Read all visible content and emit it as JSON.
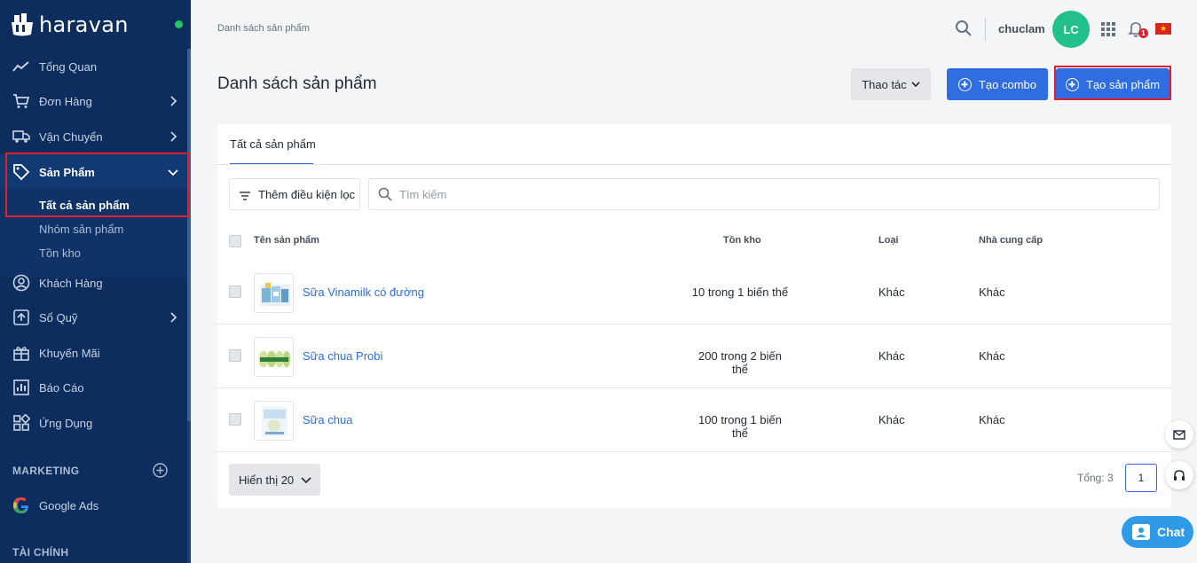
{
  "brand": {
    "name": "haravan"
  },
  "sidebar": {
    "items": [
      {
        "label": "Tổng Quan",
        "icon": "chart-line-icon"
      },
      {
        "label": "Đơn Hàng",
        "icon": "cart-icon"
      },
      {
        "label": "Vận Chuyển",
        "icon": "truck-icon"
      },
      {
        "label": "Sản Phẩm",
        "icon": "tag-icon"
      },
      {
        "label": "Khách Hàng",
        "icon": "user-circle-icon"
      },
      {
        "label": "Sổ Quỹ",
        "icon": "cashbook-icon"
      },
      {
        "label": "Khuyến Mãi",
        "icon": "gift-icon"
      },
      {
        "label": "Báo Cáo",
        "icon": "report-icon"
      },
      {
        "label": "Ứng Dụng",
        "icon": "apps-grid-icon"
      }
    ],
    "sub_items": [
      "Tất cả sản phẩm",
      "Nhóm sản phẩm",
      "Tồn kho"
    ],
    "marketing_title": "MARKETING",
    "google_ads": "Google Ads",
    "finance_title": "TÀI CHÍNH"
  },
  "topbar": {
    "breadcrumb": "Danh sách sản phẩm",
    "username": "chuclam",
    "avatar_initials": "LC",
    "notification_count": "1"
  },
  "header": {
    "title": "Danh sách sản phẩm",
    "actions_label": "Thao tác",
    "combo_label": "Tạo combo",
    "create_label": "Tạo sản phẩm"
  },
  "card": {
    "tab": "Tất cả sản phẩm",
    "filter_label": "Thêm điều kiện lọc",
    "search_placeholder": "Tìm kiếm",
    "columns": [
      "Tên sản phẩm",
      "Tồn kho",
      "Loại",
      "Nhà cung cấp"
    ],
    "rows": [
      {
        "name": "Sữa Vinamilk có đường",
        "stock": "10 trong 1 biến thể",
        "type": "Khác",
        "vendor": "Khác"
      },
      {
        "name": "Sữa chua Probi",
        "stock": "200 trong 2 biến thể",
        "type": "Khác",
        "vendor": "Khác"
      },
      {
        "name": "Sữa chua",
        "stock": "100 trong 1 biến thể",
        "type": "Khác",
        "vendor": "Khác"
      }
    ],
    "per_page": "Hiển thị 20",
    "total": "Tổng: 3",
    "page": "1"
  },
  "chat": {
    "label": "Chat"
  },
  "colors": {
    "sidebar": "#0c2d5d",
    "primary": "#2f6de0",
    "highlight": "#e11d2e"
  }
}
